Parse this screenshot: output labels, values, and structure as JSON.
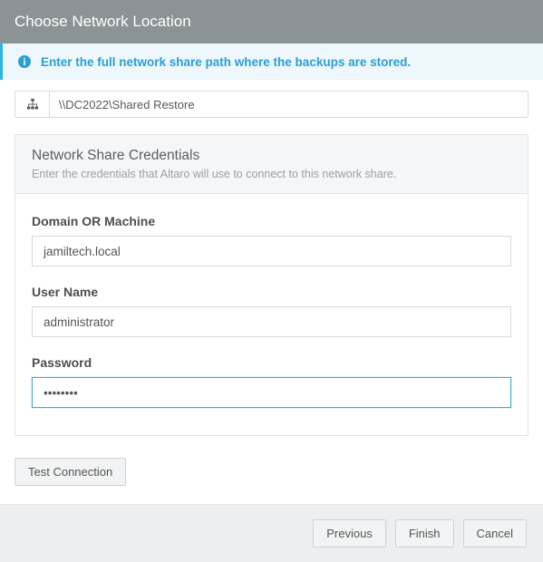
{
  "header": {
    "title": "Choose Network Location"
  },
  "info": {
    "message": "Enter the full network share path where the backups are stored.",
    "icon": "info-icon"
  },
  "path": {
    "icon": "sitemap-icon",
    "value": "\\\\DC2022\\Shared Restore"
  },
  "credentials": {
    "panel_title": "Network Share Credentials",
    "panel_subtitle": "Enter the credentials that Altaro will use to connect to this network share.",
    "domain": {
      "label": "Domain OR Machine",
      "value": "jamiltech.local"
    },
    "username": {
      "label": "User Name",
      "value": "administrator"
    },
    "password": {
      "label": "Password",
      "value": "••••••••"
    }
  },
  "actions": {
    "test": "Test Connection",
    "previous": "Previous",
    "finish": "Finish",
    "cancel": "Cancel"
  }
}
